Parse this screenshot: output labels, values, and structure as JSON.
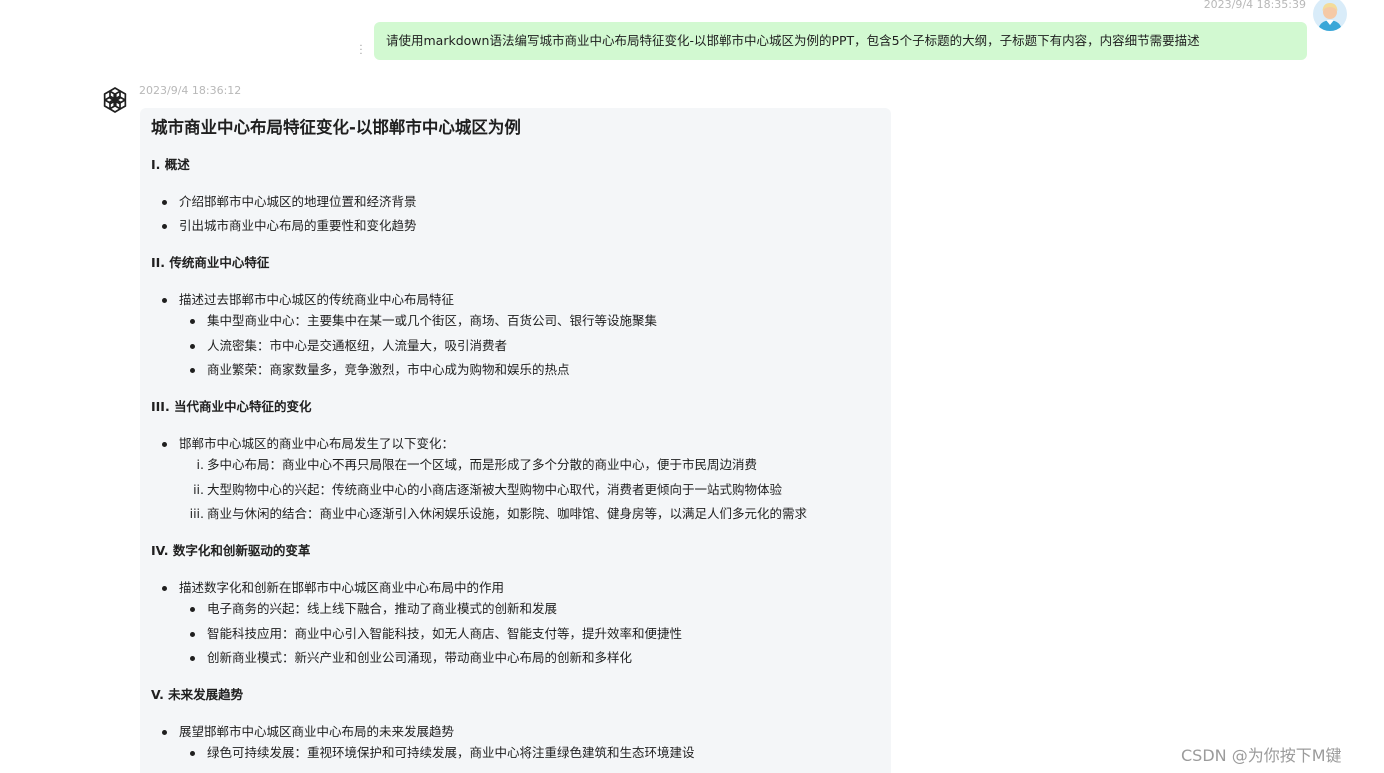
{
  "user_message": {
    "time": "2023/9/4 18:35:39",
    "text": "请使用markdown语法编写城市商业中心布局特征变化-以邯郸市中心城区为例的PPT，包含5个子标题的大纲，子标题下有内容，内容细节需要描述",
    "menu_icon": "more-vertical-icon",
    "avatar": "user-avatar-icon"
  },
  "assistant_message": {
    "time": "2023/9/4 18:36:12",
    "avatar": "openai-logo-icon",
    "title": "城市商业中心布局特征变化-以邯郸市中心城区为例",
    "s1": {
      "heading": "I. 概述",
      "items": [
        "介绍邯郸市中心城区的地理位置和经济背景",
        "引出城市商业中心布局的重要性和变化趋势"
      ]
    },
    "s2": {
      "heading": "II. 传统商业中心特征",
      "lead": "描述过去邯郸市中心城区的传统商业中心布局特征",
      "items": [
        "集中型商业中心：主要集中在某一或几个街区，商场、百货公司、银行等设施聚集",
        "人流密集：市中心是交通枢纽，人流量大，吸引消费者",
        "商业繁荣：商家数量多，竞争激烈，市中心成为购物和娱乐的热点"
      ]
    },
    "s3": {
      "heading": "III. 当代商业中心特征的变化",
      "lead": "邯郸市中心城区的商业中心布局发生了以下变化：",
      "markers": [
        "i.",
        "ii.",
        "iii."
      ],
      "items": [
        "多中心布局：商业中心不再只局限在一个区域，而是形成了多个分散的商业中心，便于市民周边消费",
        "大型购物中心的兴起：传统商业中心的小商店逐渐被大型购物中心取代，消费者更倾向于一站式购物体验",
        "商业与休闲的结合：商业中心逐渐引入休闲娱乐设施，如影院、咖啡馆、健身房等，以满足人们多元化的需求"
      ]
    },
    "s4": {
      "heading": "IV. 数字化和创新驱动的变革",
      "lead": "描述数字化和创新在邯郸市中心城区商业中心布局中的作用",
      "items": [
        "电子商务的兴起：线上线下融合，推动了商业模式的创新和发展",
        "智能科技应用：商业中心引入智能科技，如无人商店、智能支付等，提升效率和便捷性",
        "创新商业模式：新兴产业和创业公司涌现，带动商业中心布局的创新和多样化"
      ]
    },
    "s5": {
      "heading": "V. 未来发展趋势",
      "lead": "展望邯郸市中心城区商业中心布局的未来发展趋势",
      "items": [
        "绿色可持续发展：重视环境保护和可持续发展，商业中心将注重绿色建筑和生态环境建设"
      ]
    }
  },
  "watermark": "CSDN @为你按下M键"
}
